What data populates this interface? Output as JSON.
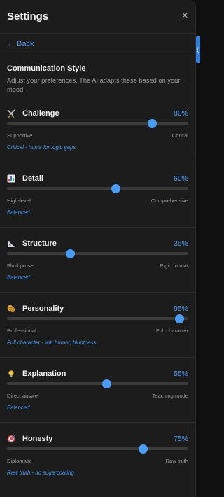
{
  "header": {
    "title": "Settings",
    "close_glyph": "×"
  },
  "back_label": "← Back",
  "section": {
    "title": "Communication Style",
    "description": "Adjust your preferences. The AI adapts these based on your mood."
  },
  "accent_color": "#4b9cf7",
  "settings": [
    {
      "icon": "crossed-swords-icon",
      "label": "Challenge",
      "value_text": "80%",
      "value": 0.8,
      "min_label": "Supportive",
      "max_label": "Critical",
      "note": "Critical - hunts for logic gaps"
    },
    {
      "icon": "bar-chart-icon",
      "label": "Detail",
      "value_text": "60%",
      "value": 0.6,
      "min_label": "High-level",
      "max_label": "Comprehensive",
      "note": "Balanced"
    },
    {
      "icon": "triangular-ruler-icon",
      "label": "Structure",
      "value_text": "35%",
      "value": 0.35,
      "min_label": "Fluid prose",
      "max_label": "Rigid format",
      "note": "Balanced"
    },
    {
      "icon": "theater-masks-icon",
      "label": "Personality",
      "value_text": "95%",
      "value": 0.95,
      "min_label": "Professional",
      "max_label": "Full character",
      "note": "Full character - wit, humor, bluntness"
    },
    {
      "icon": "light-bulb-icon",
      "label": "Explanation",
      "value_text": "55%",
      "value": 0.55,
      "min_label": "Direct answer",
      "max_label": "Teaching mode",
      "note": "Balanced"
    },
    {
      "icon": "target-icon",
      "label": "Honesty",
      "value_text": "75%",
      "value": 0.75,
      "min_label": "Diplomatic",
      "max_label": "Raw truth",
      "note": "Raw truth - no sugarcoating"
    }
  ]
}
